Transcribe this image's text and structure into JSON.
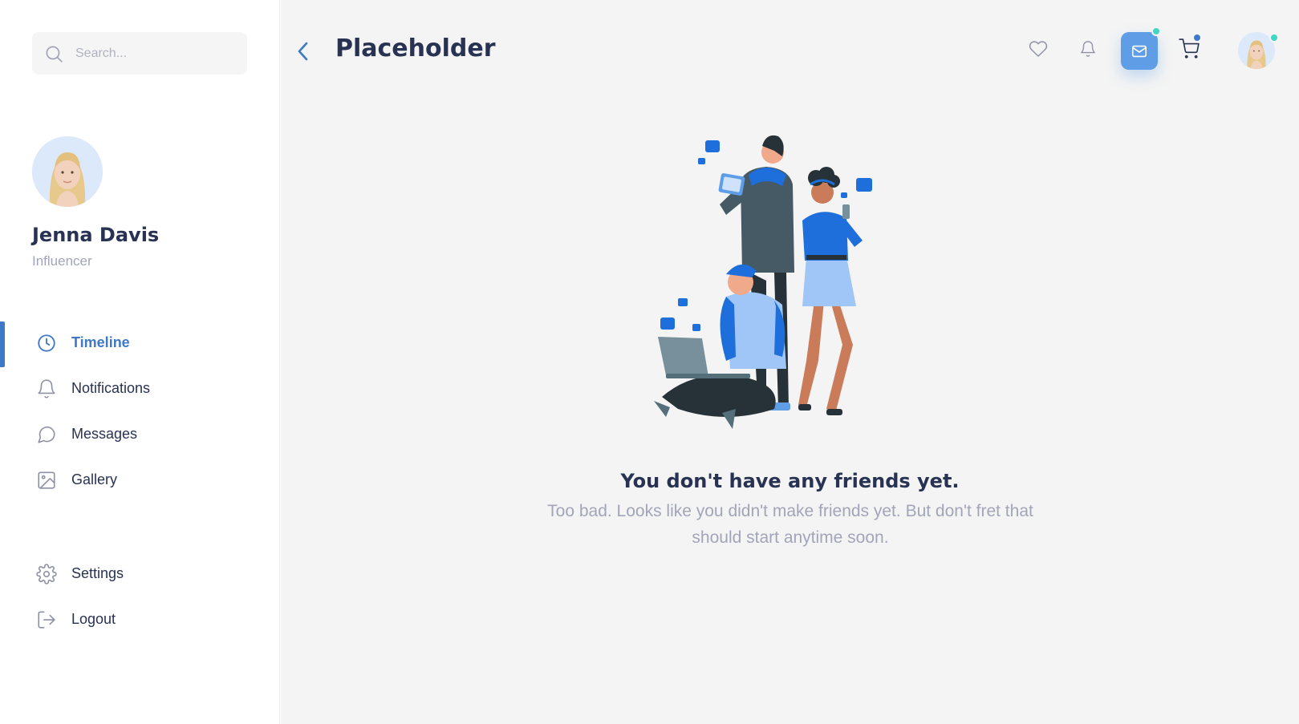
{
  "search": {
    "placeholder": "Search..."
  },
  "profile": {
    "name": "Jenna Davis",
    "role": "Influencer"
  },
  "nav": {
    "items": [
      {
        "label": "Timeline",
        "icon": "clock-icon",
        "active": true
      },
      {
        "label": "Notifications",
        "icon": "bell-icon"
      },
      {
        "label": "Messages",
        "icon": "message-icon"
      },
      {
        "label": "Gallery",
        "icon": "image-icon"
      }
    ],
    "bottom": [
      {
        "label": "Settings",
        "icon": "gear-icon"
      },
      {
        "label": "Logout",
        "icon": "logout-icon"
      }
    ]
  },
  "header": {
    "title": "Placeholder",
    "icons": [
      "heart-icon",
      "bell-icon",
      "mail-icon",
      "cart-icon",
      "avatar"
    ]
  },
  "empty_state": {
    "title": "You don't have any friends yet.",
    "text": "Too bad. Looks like you didn't make friends yet. But don't fret that should start anytime soon."
  },
  "colors": {
    "accent": "#3e78c8",
    "mail_button": "#5f9ee7",
    "online_dot": "#41d6c3",
    "cart_dot": "#3e78c8",
    "background": "#f4f4f4",
    "text_dark": "#283252",
    "text_muted": "#a2a5b9"
  }
}
